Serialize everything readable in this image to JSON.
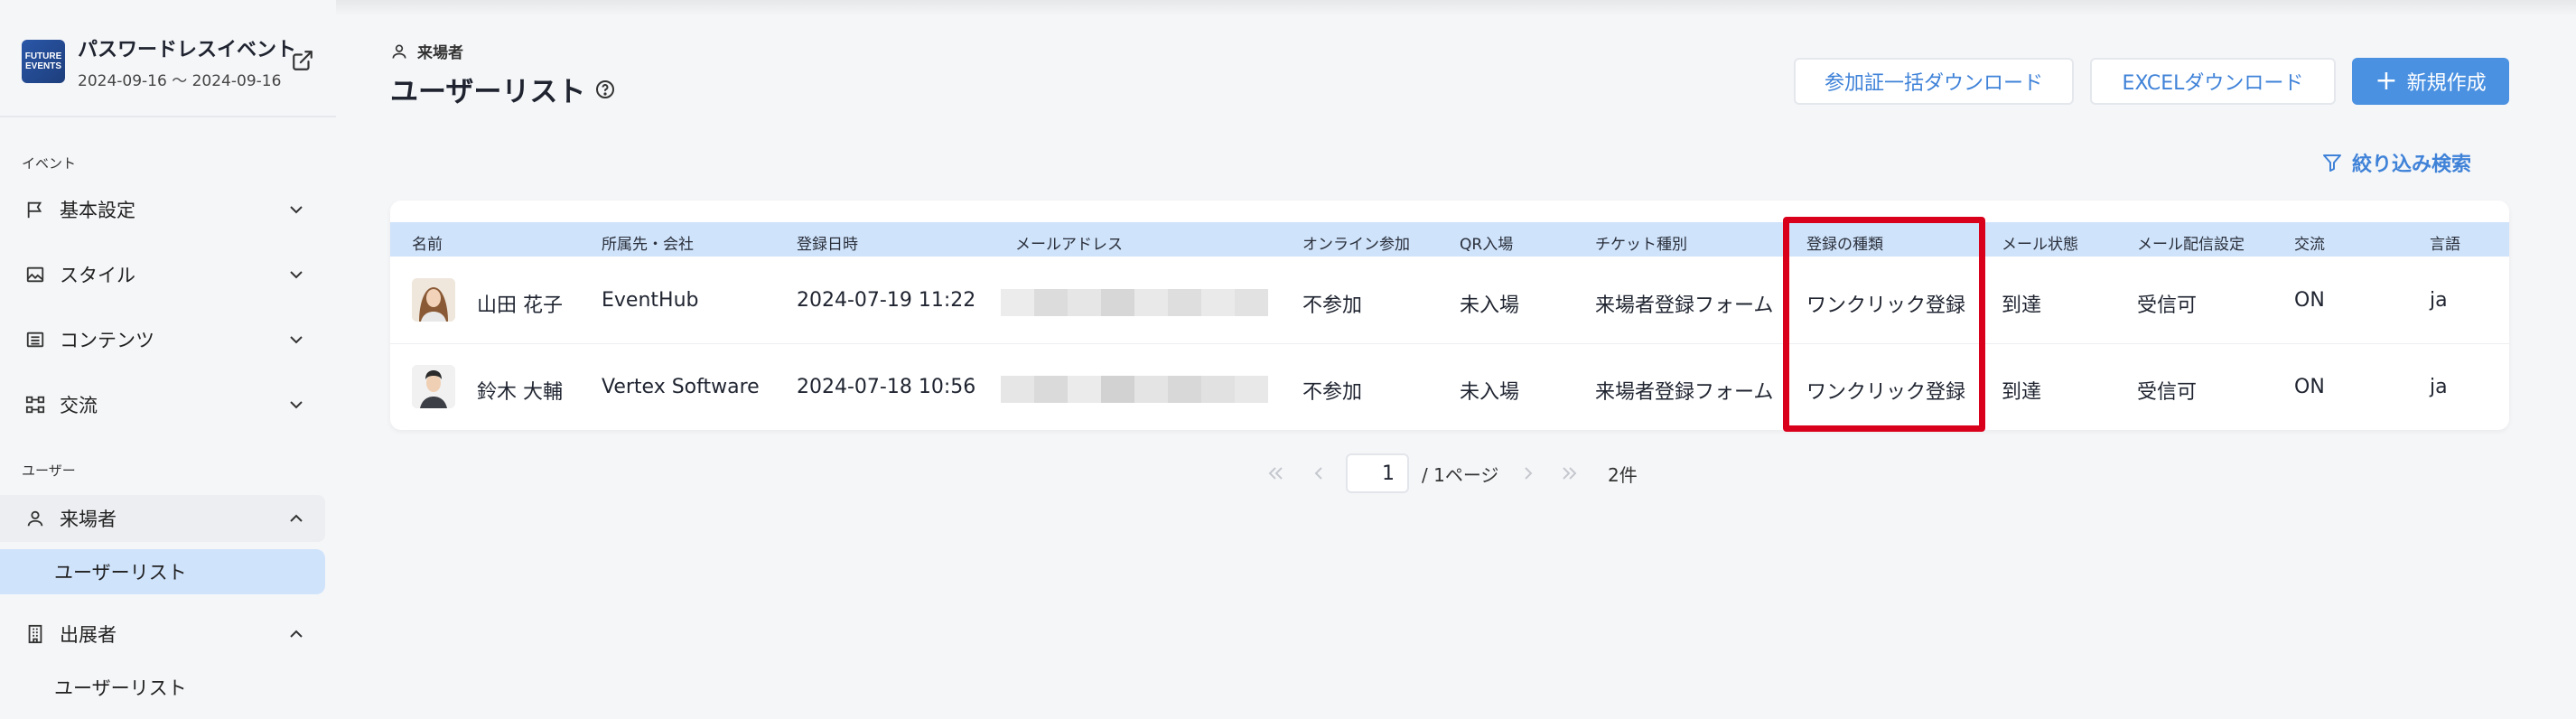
{
  "event": {
    "logo_text": "FUTURE EVENTS",
    "title": "パスワードレスイベント",
    "dates": "2024-09-16 〜 2024-09-16"
  },
  "sidebar": {
    "section_event": "イベント",
    "section_user": "ユーザー",
    "items": [
      {
        "label": "基本設定",
        "icon": "flag-icon"
      },
      {
        "label": "スタイル",
        "icon": "image-icon"
      },
      {
        "label": "コンテンツ",
        "icon": "list-icon"
      },
      {
        "label": "交流",
        "icon": "network-icon"
      }
    ],
    "visitors": {
      "label": "来場者",
      "sub": "ユーザーリスト"
    },
    "exhibitors": {
      "label": "出展者",
      "sub": "ユーザーリスト"
    }
  },
  "header": {
    "breadcrumb": "来場者",
    "title": "ユーザーリスト",
    "btn_download_passes": "参加証一括ダウンロード",
    "btn_excel": "EXCELダウンロード",
    "btn_new": "新規作成",
    "filter": "絞り込み検索"
  },
  "table": {
    "columns": [
      "名前",
      "所属先・会社",
      "登録日時",
      "メールアドレス",
      "オンライン参加",
      "QR入場",
      "チケット種別",
      "登録の種類",
      "メール状態",
      "メール配信設定",
      "交流",
      "言語"
    ],
    "rows": [
      {
        "name": "山田 花子",
        "company": "EventHub",
        "registered": "2024-07-19 11:22",
        "online": "不参加",
        "qr": "未入場",
        "ticket": "来場者登録フォーム",
        "reg_type": "ワンクリック登録",
        "mail_status": "到達",
        "mail_setting": "受信可",
        "network": "ON",
        "lang": "ja"
      },
      {
        "name": "鈴木 大輔",
        "company": "Vertex Software",
        "registered": "2024-07-18 10:56",
        "online": "不参加",
        "qr": "未入場",
        "ticket": "来場者登録フォーム",
        "reg_type": "ワンクリック登録",
        "mail_status": "到達",
        "mail_setting": "受信可",
        "network": "ON",
        "lang": "ja"
      }
    ]
  },
  "pagination": {
    "current": "1",
    "of_pages": "/ 1ページ",
    "total": "2件"
  },
  "colors": {
    "accent": "#4a91e2",
    "header_row": "#cfe3fb",
    "highlight": "#d9001b"
  }
}
